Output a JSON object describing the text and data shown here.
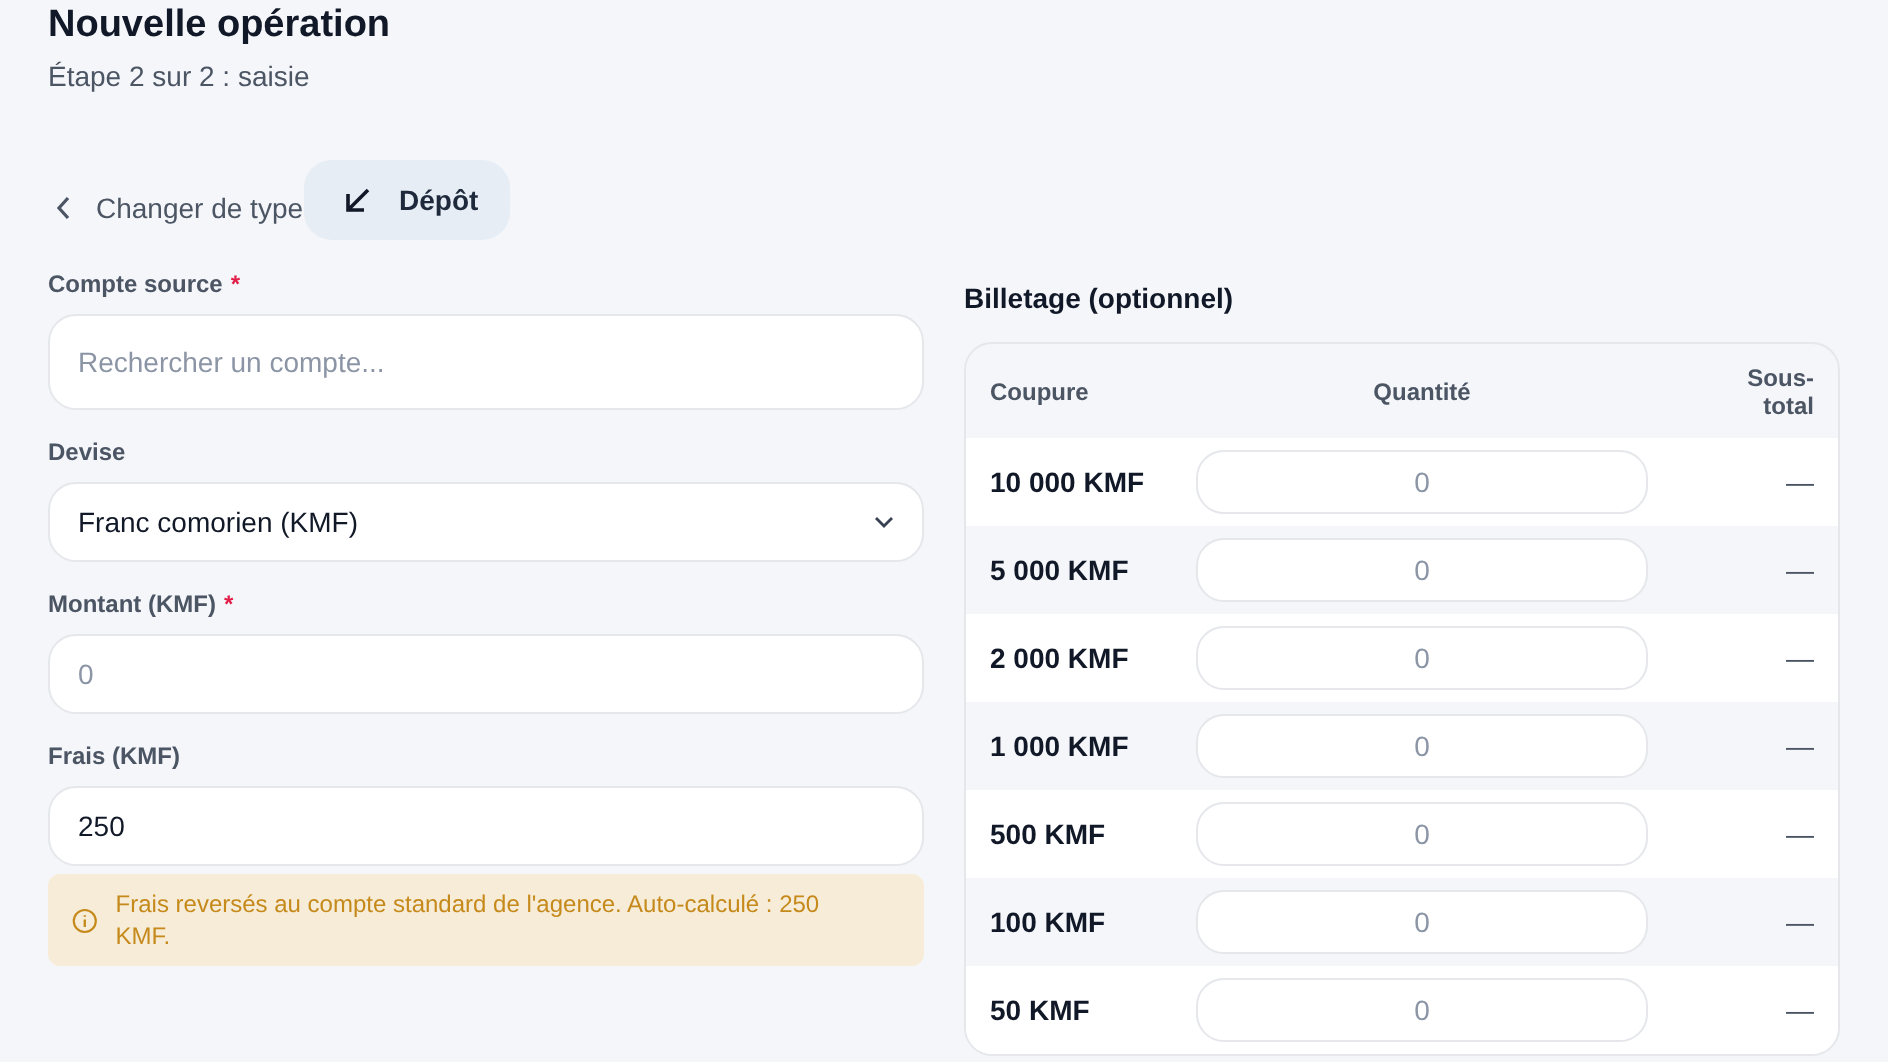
{
  "header": {
    "title": "Nouvelle opération",
    "subtitle": "Étape 2 sur 2 : saisie"
  },
  "type_bar": {
    "back_link": "Changer de type",
    "selected_type": "Dépôt"
  },
  "fields": [
    {
      "kind": "search",
      "label": "Compte source",
      "required_mark": "*",
      "placeholder": "Rechercher un compte..."
    },
    {
      "kind": "select",
      "label": "Devise",
      "value": "Franc comorien (KMF)"
    },
    {
      "kind": "input",
      "label": "Montant (KMF)",
      "required_mark": "*",
      "placeholder": "0"
    },
    {
      "kind": "input",
      "label": "Frais (KMF)",
      "value": "250"
    }
  ],
  "notice": "Frais reversés au compte standard de l'agence. Auto-calculé : 250 KMF.",
  "billetage": {
    "title": "Billetage (optionnel)",
    "columns": [
      "Coupure",
      "Quantité",
      "Sous-total"
    ],
    "rows": [
      {
        "denomination": "10 000 KMF",
        "placeholder": "0",
        "subtotal": "—"
      },
      {
        "denomination": "5 000 KMF",
        "placeholder": "0",
        "subtotal": "—"
      },
      {
        "denomination": "2 000 KMF",
        "placeholder": "0",
        "subtotal": "—"
      },
      {
        "denomination": "1 000 KMF",
        "placeholder": "0",
        "subtotal": "—"
      },
      {
        "denomination": "500 KMF",
        "placeholder": "0",
        "subtotal": "—"
      },
      {
        "denomination": "100 KMF",
        "placeholder": "0",
        "subtotal": "—"
      },
      {
        "denomination": "50 KMF",
        "placeholder": "0",
        "subtotal": "—"
      }
    ]
  }
}
